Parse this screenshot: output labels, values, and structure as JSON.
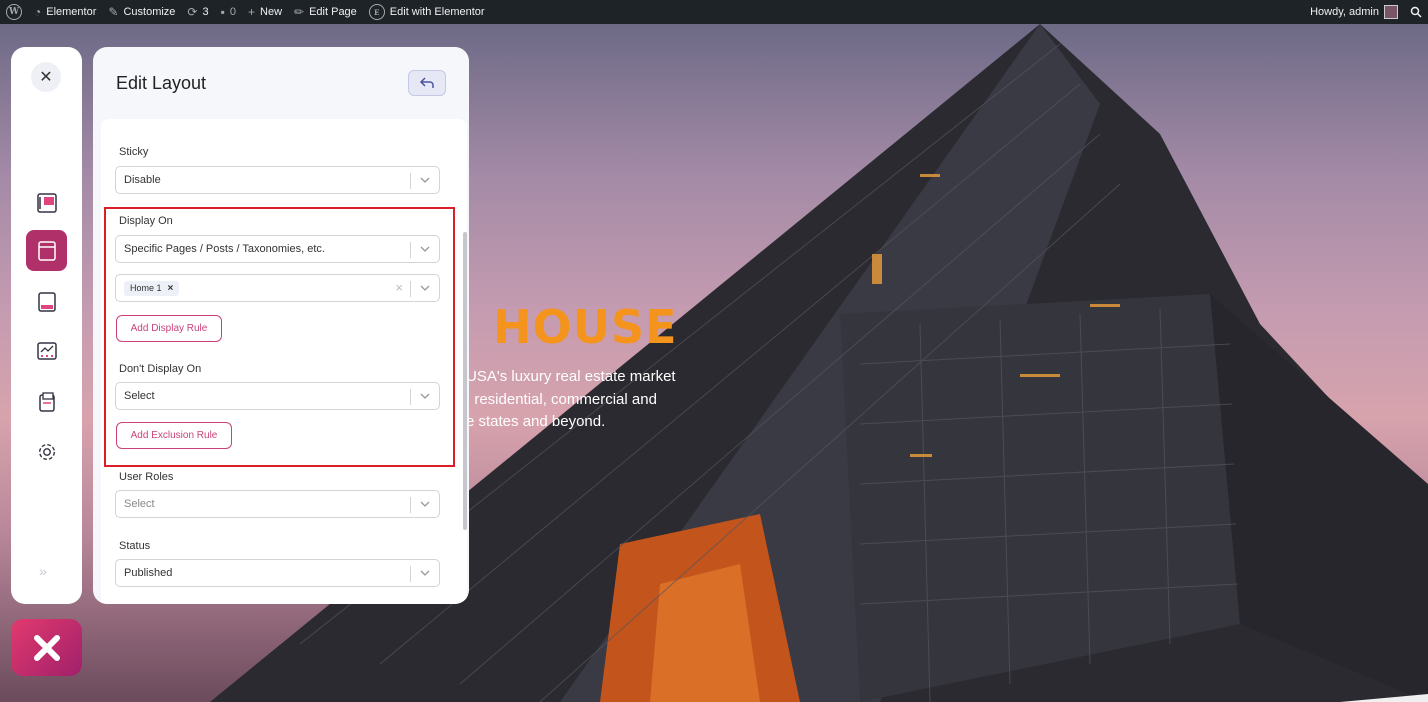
{
  "adminbar": {
    "items": [
      {
        "icon": "wordpress-logo",
        "label": ""
      },
      {
        "icon": "dashboard-icon",
        "label": "Elementor"
      },
      {
        "icon": "brush-icon",
        "label": "Customize"
      },
      {
        "icon": "updates-icon",
        "label": "3"
      },
      {
        "icon": "comment-icon",
        "label": "0"
      },
      {
        "icon": "plus-icon",
        "label": "New"
      },
      {
        "icon": "pencil-icon",
        "label": "Edit Page"
      },
      {
        "icon": "elementor-icon",
        "label": "Edit with Elementor"
      }
    ],
    "greeting": "Howdy, admin"
  },
  "hero": {
    "title": "HOUSE",
    "text": "USA's luxury real estate market\n: residential, commercial and\ne states and beyond."
  },
  "rail": {
    "icons": [
      "header-layout-icon",
      "page-layout-icon",
      "footer-layout-icon",
      "archive-layout-icon",
      "single-layout-icon",
      "settings-icon"
    ],
    "active_index": 1,
    "more": "»"
  },
  "panel": {
    "title": "Edit Layout",
    "sticky": {
      "label": "Sticky",
      "value": "Disable"
    },
    "display_on": {
      "label": "Display On",
      "value": "Specific Pages / Posts / Taxonomies, etc.",
      "tags": [
        "Home 1"
      ],
      "add_button": "Add Display Rule"
    },
    "dont_display_on": {
      "label": "Don't Display On",
      "value": "Select",
      "add_button": "Add Exclusion Rule"
    },
    "user_roles": {
      "label": "User Roles",
      "placeholder": "Select"
    },
    "status": {
      "label": "Status",
      "value": "Published"
    }
  },
  "colors": {
    "accent": "#b0306a",
    "highlight": "#d81f2a",
    "hero_title": "#f5941d",
    "adminbar": "#1d2327"
  }
}
